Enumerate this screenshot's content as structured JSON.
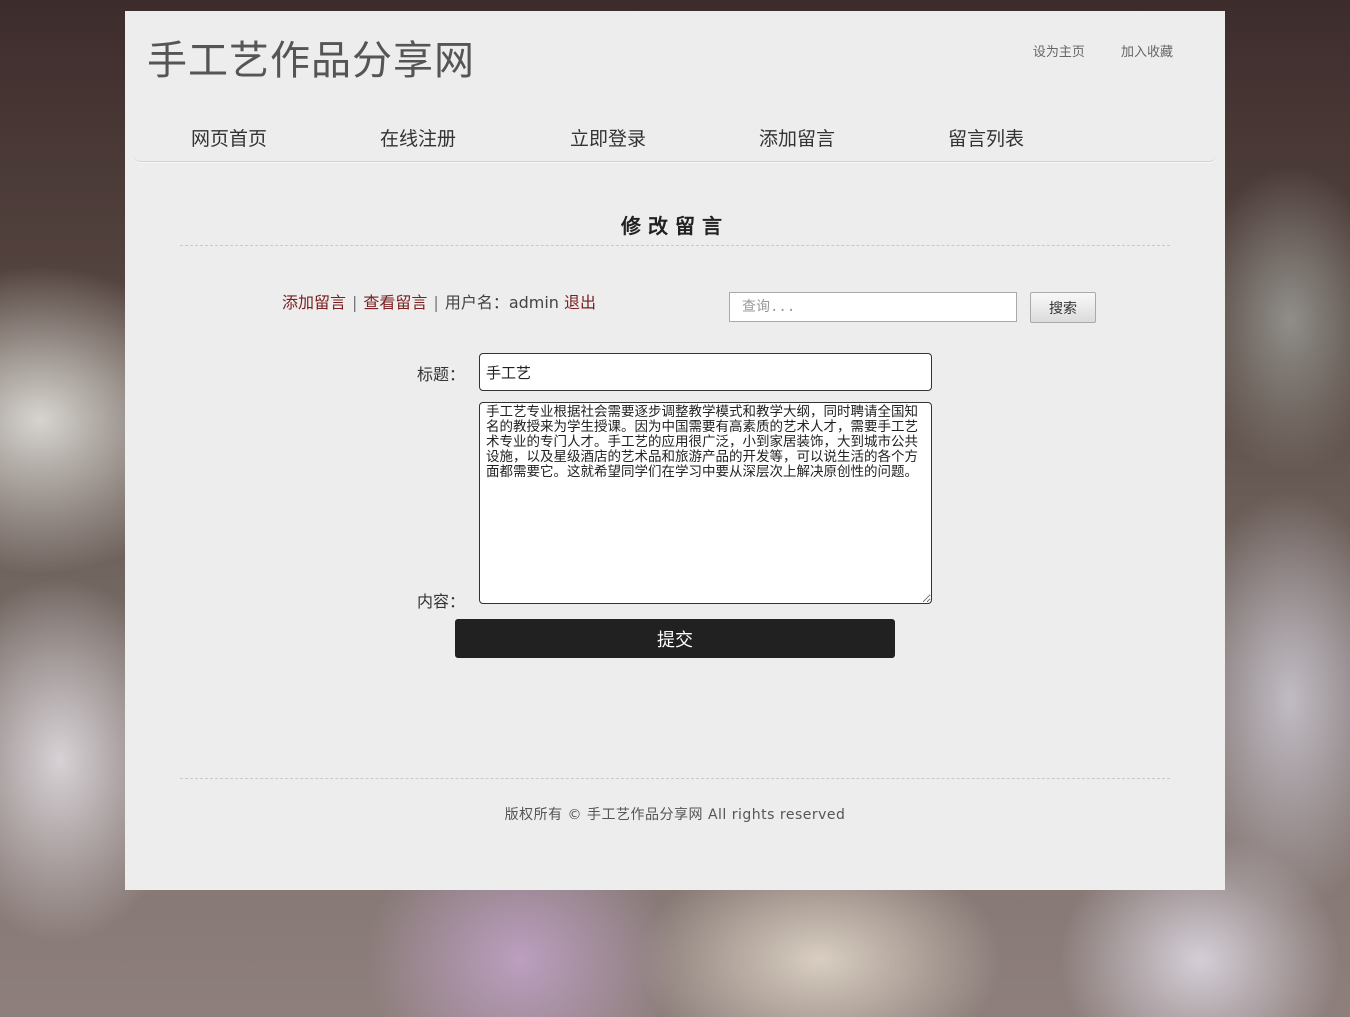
{
  "site": {
    "title": "手工艺作品分享网"
  },
  "top_links": {
    "home": "设为主页",
    "favorite": "加入收藏"
  },
  "nav": {
    "items": [
      "网页首页",
      "在线注册",
      "立即登录",
      "添加留言",
      "留言列表"
    ]
  },
  "section": {
    "title": "修改留言"
  },
  "toolbar": {
    "add": "添加留言",
    "sep": "|",
    "view": "查看留言",
    "user_label": "用户名：admin",
    "logout": "退出"
  },
  "search": {
    "placeholder": "查询...",
    "button": "搜索"
  },
  "form": {
    "title_label": "标题：",
    "title_value": "手工艺",
    "content_label": "内容：",
    "content_value": "手工艺专业根据社会需要逐步调整教学模式和教学大纲，同时聘请全国知名的教授来为学生授课。因为中国需要有高素质的艺术人才，需要手工艺术专业的专门人才。手工艺的应用很广泛，小到家居装饰，大到城市公共设施，以及星级酒店的艺术品和旅游产品的开发等，可以说生活的各个方面都需要它。这就希望同学们在学习中要从深层次上解决原创性的问题。",
    "submit": "提交"
  },
  "footer": {
    "text": "版权所有 © 手工艺作品分享网 All rights reserved"
  }
}
